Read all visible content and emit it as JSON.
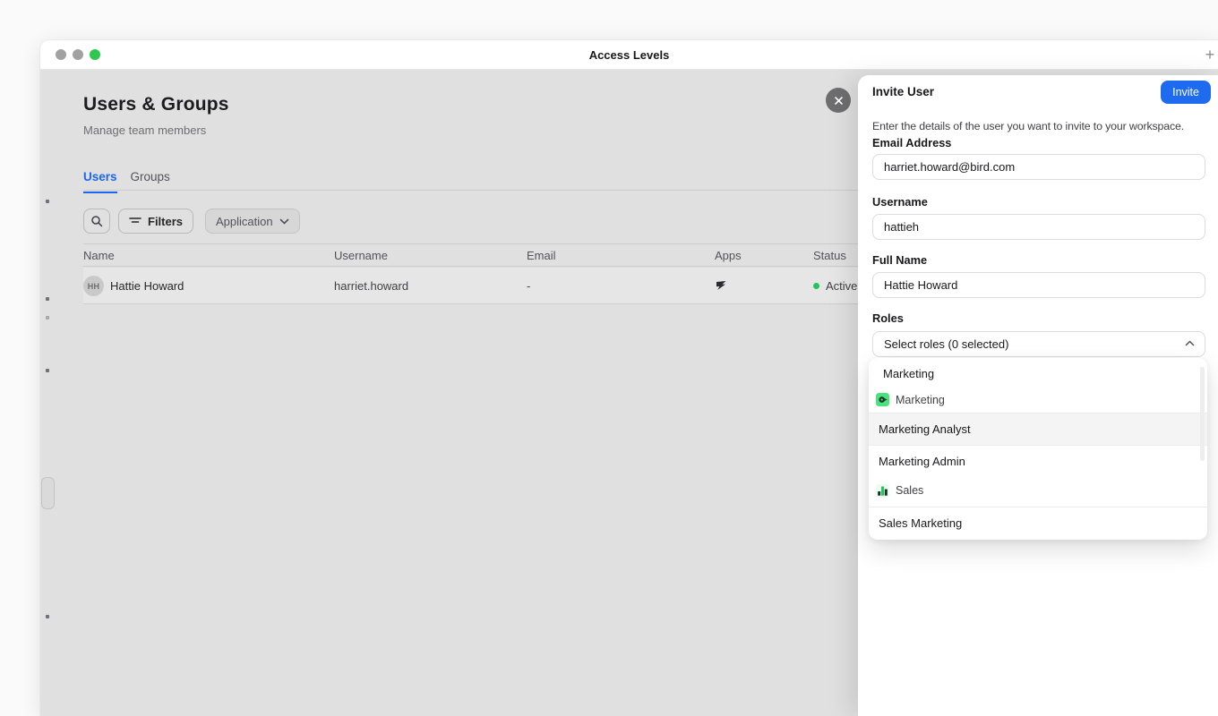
{
  "window": {
    "title": "Access Levels",
    "plus_label": "+"
  },
  "main": {
    "title": "Users & Groups",
    "subtitle": "Manage team members",
    "tabs": {
      "users": "Users",
      "groups": "Groups"
    },
    "toolbar": {
      "filters": "Filters",
      "application": "Application"
    },
    "table": {
      "headers": {
        "name": "Name",
        "username": "Username",
        "email": "Email",
        "apps": "Apps",
        "status": "Status"
      },
      "row": {
        "initials": "HH",
        "name": "Hattie Howard",
        "username": "harriet.howard",
        "email": "-",
        "status": "Active"
      }
    }
  },
  "panel": {
    "title": "Invite User",
    "invite": "Invite",
    "description": "Enter the details of the user you want to invite to your workspace.",
    "email_label": "Email Address",
    "email_value": "harriet.howard@bird.com",
    "username_label": "Username",
    "username_value": "hattieh",
    "fullname_label": "Full Name",
    "fullname_value": "Hattie Howard",
    "roles_label": "Roles",
    "roles_select": "Select roles (0 selected)",
    "options": [
      {
        "type": "role",
        "label": "Marketing"
      },
      {
        "type": "group",
        "label": "Marketing",
        "icon": "marketing-app-icon"
      },
      {
        "type": "role",
        "label": "Marketing Analyst",
        "highlighted": true
      },
      {
        "type": "role",
        "label": "Marketing Admin"
      },
      {
        "type": "group",
        "label": "Sales",
        "icon": "sales-app-icon"
      },
      {
        "type": "role",
        "label": "Sales Marketing"
      }
    ]
  },
  "colors": {
    "accent_blue": "#1f6bf0",
    "tab_blue": "#1a66f0",
    "green": "#22c55e",
    "content_bg": "#e0e0e0",
    "highlight_row": "#f4f4f5"
  }
}
